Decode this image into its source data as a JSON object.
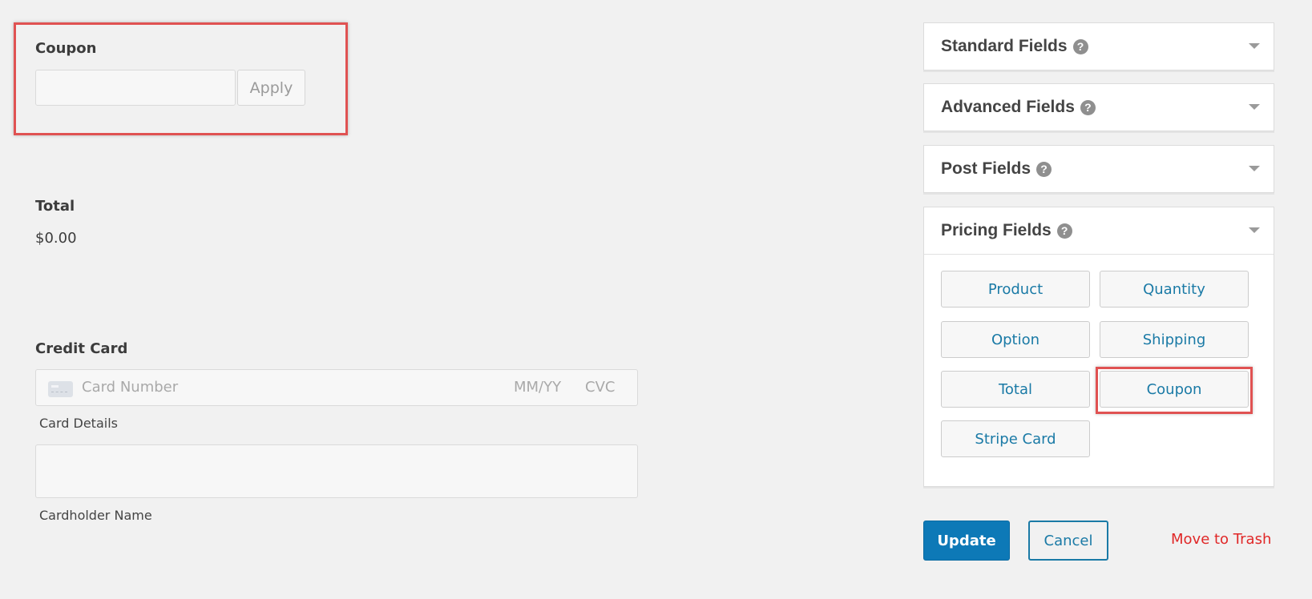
{
  "form": {
    "coupon": {
      "label": "Coupon",
      "input_value": "",
      "apply_label": "Apply"
    },
    "total": {
      "label": "Total",
      "value": "$0.00"
    },
    "credit_card": {
      "label": "Credit Card",
      "card_number_placeholder": "Card Number",
      "expiry_placeholder": "MM/YY",
      "cvc_placeholder": "CVC",
      "card_details_label": "Card Details",
      "cardholder_name_value": "",
      "cardholder_name_label": "Cardholder Name"
    }
  },
  "sidebar": {
    "panels": [
      {
        "title": "Standard Fields",
        "help": "?"
      },
      {
        "title": "Advanced Fields",
        "help": "?"
      },
      {
        "title": "Post Fields",
        "help": "?"
      },
      {
        "title": "Pricing Fields",
        "help": "?"
      }
    ],
    "pricing_buttons": [
      "Product",
      "Quantity",
      "Option",
      "Shipping",
      "Total",
      "Coupon",
      "Stripe Card"
    ],
    "highlighted_button": "Coupon"
  },
  "actions": {
    "update_label": "Update",
    "cancel_label": "Cancel",
    "trash_label": "Move to Trash"
  },
  "colors": {
    "background": "#f1f1f1",
    "highlight": "#e05252",
    "link": "#1a7aa6",
    "primary": "#0d79b7",
    "danger": "#e02828"
  }
}
